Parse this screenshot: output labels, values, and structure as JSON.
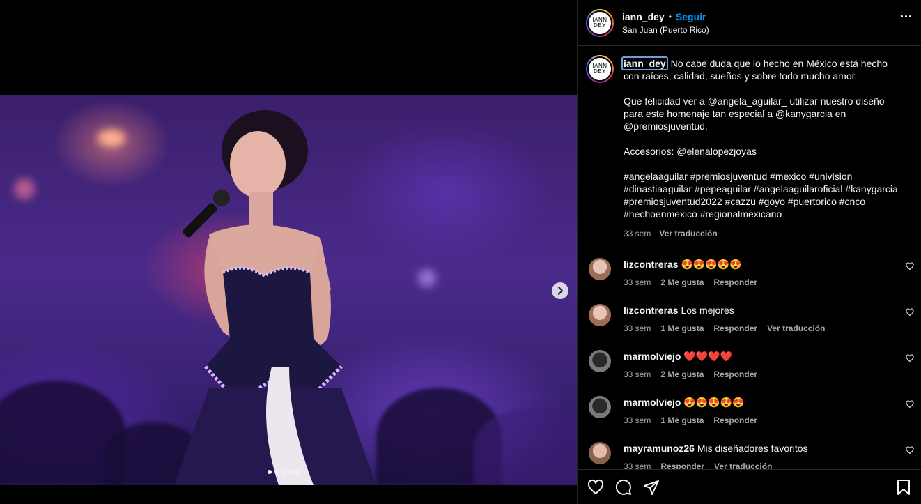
{
  "post": {
    "username": "iann_dey",
    "follow_label": "Seguir",
    "bullet": "•",
    "location": "San Juan (Puerto Rico)",
    "avatar_text_1": "IANN",
    "avatar_text_2": "DEY"
  },
  "caption": {
    "username": "iann_dey",
    "line1": "No cabe duda que lo hecho en México está hecho con raíces, calidad, sueños y sobre todo mucho amor.",
    "line2": "Que felicidad ver a @angela_aguilar_ utilizar nuestro diseño para este homenaje tan especial a @kanygarcia en @premiosjuventud.",
    "line3": "Accesorios: @elenalopezjoyas",
    "hashtags": "#angelaaguilar #premiosjuventud #mexico #univision #dinastiaaguilar #pepeaguilar #angelaaguilaroficial #kanygarcia #premiosjuventud2022 #cazzu #goyo #puertorico #cnco #hechoenmexico #regionalmexicano",
    "time": "33 sem",
    "translate": "Ver traducción"
  },
  "comments": [
    {
      "user": "lizcontreras",
      "text": "😍😍😍😍😍",
      "time": "33 sem",
      "likes": "2 Me gusta",
      "reply": "Responder",
      "translate": "",
      "avatar_color": "#c9a38a"
    },
    {
      "user": "lizcontreras",
      "text": "Los mejores",
      "time": "33 sem",
      "likes": "1 Me gusta",
      "reply": "Responder",
      "translate": "Ver traducción",
      "avatar_color": "#c9a38a"
    },
    {
      "user": "marmolviejo",
      "text": "❤️❤️❤️❤️",
      "time": "33 sem",
      "likes": "2 Me gusta",
      "reply": "Responder",
      "translate": "",
      "avatar_color": "#5a5a5a"
    },
    {
      "user": "marmolviejo",
      "text": "😍😍😍😍😍",
      "time": "33 sem",
      "likes": "1 Me gusta",
      "reply": "Responder",
      "translate": "",
      "avatar_color": "#5a5a5a"
    },
    {
      "user": "mayramunoz26",
      "text": "Mis diseñadores favoritos",
      "time": "33 sem",
      "likes": "",
      "reply": "Responder",
      "translate": "Ver traducción",
      "avatar_color": "#b9927a"
    }
  ],
  "carousel": {
    "total": 5,
    "active": 0
  },
  "colors": {
    "accent": "#0095f6",
    "muted": "#a8a8a8",
    "border": "#262626"
  }
}
